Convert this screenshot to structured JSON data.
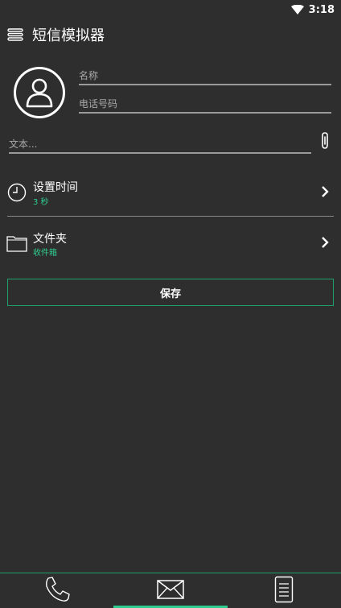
{
  "status_bar": {
    "time": "3:18"
  },
  "app": {
    "title": "短信模拟器"
  },
  "contact": {
    "name_placeholder": "名称",
    "phone_placeholder": "电话号码"
  },
  "message": {
    "text_placeholder": "文本..."
  },
  "settings": [
    {
      "label": "设置时间",
      "value": "3 秒"
    },
    {
      "label": "文件夹",
      "value": "收件箱"
    }
  ],
  "actions": {
    "save_label": "保存"
  },
  "bottom_nav": {
    "tabs": [
      {
        "icon": "phone-icon"
      },
      {
        "icon": "envelope-icon",
        "active": true
      },
      {
        "icon": "document-icon"
      }
    ]
  },
  "colors": {
    "background": "#2e2e2e",
    "accent": "#2ecc8f",
    "border_accent": "#1f9e6a"
  }
}
